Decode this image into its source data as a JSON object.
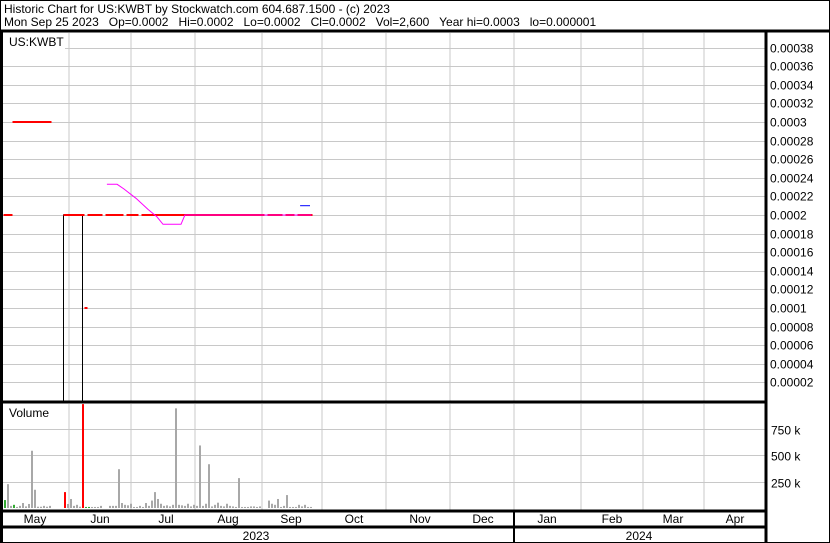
{
  "header": {
    "title_line": "Historic Chart for US:KWBT by Stockwatch.com 604.687.1500 - (c) 2023",
    "quote_line": "Mon Sep 25 2023   Op=0.0002   Hi=0.0002   Lo=0.0002   Cl=0.0002   Vol=2,600   Year hi=0.0003   lo=0.000001"
  },
  "chart_data": {
    "type": "bar",
    "symbol_label": "US:KWBT",
    "volume_label": "Volume",
    "price_axis": {
      "min": 0,
      "max": 0.0004,
      "ticks": [
        "0.00038",
        "0.00036",
        "0.00034",
        "0.00032",
        "0.0003",
        "0.00028",
        "0.00026",
        "0.00024",
        "0.00022",
        "0.0002",
        "0.00018",
        "0.00016",
        "0.00014",
        "0.00012",
        "0.0001",
        "0.00008",
        "0.00006",
        "0.00004",
        "0.00002"
      ]
    },
    "volume_axis": {
      "min": 0,
      "max": 1000000,
      "ticks": [
        {
          "label": "750 k",
          "value": 750000
        },
        {
          "label": "500 k",
          "value": 500000
        },
        {
          "label": "250 k",
          "value": 250000
        }
      ]
    },
    "months": [
      "May",
      "Jun",
      "Jul",
      "Aug",
      "Sep",
      "Oct",
      "Nov",
      "Dec",
      "Jan",
      "Feb",
      "Mar",
      "Apr"
    ],
    "years": [
      "2023",
      "2024"
    ],
    "trading_day_count": 103,
    "closes": [
      0.0002,
      0.0002,
      0.0002,
      0.0003,
      0.0003,
      0.0003,
      0.0003,
      0.0003,
      0.0003,
      0.0003,
      0.0003,
      0.0003,
      0.0003,
      0.0003,
      0.0003,
      0.0003,
      null,
      null,
      null,
      null,
      0.0002,
      0.0002,
      0.0002,
      0.0002,
      0.0002,
      0.0002,
      0.0002,
      0.0001,
      0.0002,
      0.0002,
      0.0002,
      0.0002,
      0.0002,
      null,
      0.0002,
      0.0002,
      0.0002,
      0.0002,
      0.0002,
      0.0002,
      null,
      0.0002,
      0.0002,
      0.0002,
      0.0002,
      null,
      0.0002,
      0.0002,
      0.0002,
      0.0002,
      0.0002,
      0.0002,
      0.0002,
      0.0002,
      0.0002,
      0.0002,
      0.0002,
      0.0002,
      0.0002,
      0.0002,
      0.0002,
      0.0002,
      0.0002,
      0.0002,
      0.0002,
      0.0002,
      0.0002,
      0.0002,
      0.0002,
      0.0002,
      0.0002,
      0.0002,
      0.0002,
      0.0002,
      0.0002,
      0.0002,
      0.0002,
      0.0002,
      0.0002,
      0.0002,
      0.0002,
      0.0002,
      0.0002,
      0.0002,
      0.0002,
      0.0002,
      0.0002,
      null,
      0.0002,
      0.0002,
      0.0002,
      0.0002,
      0.0002,
      null,
      0.0002,
      0.0002,
      0.0002,
      null,
      0.0002,
      0.0002,
      0.0002,
      0.0002,
      0.0002
    ],
    "hollow_candle": {
      "from_day": 20,
      "to_day": 26,
      "high": 0.0002,
      "low": 0
    },
    "moving_average": [
      [
        34.3,
        0.000233
      ],
      [
        37.7,
        0.000233
      ],
      [
        40,
        0.000228
      ],
      [
        44,
        0.000218
      ],
      [
        48,
        0.000206
      ],
      [
        51,
        0.000198
      ],
      [
        53,
        0.00019
      ],
      [
        59,
        0.00019
      ],
      [
        60.3,
        0.0002
      ],
      [
        102.5,
        0.0002
      ]
    ],
    "blue_mark": {
      "from_day": 98.7,
      "to_day": 102,
      "value": 0.00021
    },
    "volumes_k": [
      75,
      225,
      20,
      30,
      10,
      20,
      47,
      15,
      38,
      540,
      172,
      12,
      12,
      20,
      12,
      20,
      0,
      0,
      0,
      0,
      150,
      38,
      85,
      20,
      30,
      12,
      980,
      10,
      10,
      10,
      10,
      10,
      20,
      0,
      0,
      20,
      20,
      20,
      366,
      47,
      30,
      25,
      40,
      10,
      10,
      20,
      10,
      47,
      20,
      70,
      150,
      85,
      40,
      20,
      25,
      15,
      30,
      940,
      30,
      25,
      20,
      40,
      15,
      30,
      20,
      590,
      20,
      40,
      413,
      15,
      30,
      50,
      20,
      15,
      40,
      20,
      15,
      10,
      282,
      10,
      10,
      10,
      15,
      15,
      10,
      15,
      0,
      0,
      70,
      40,
      30,
      85,
      10,
      20,
      122,
      10,
      10,
      10,
      30,
      15,
      30,
      10,
      10
    ],
    "up_days": [
      0,
      3,
      27,
      28
    ],
    "down_days": [
      20,
      26
    ],
    "colors": {
      "price": "#ff0000",
      "ma": "#ff00ff",
      "blue": "#0000ff",
      "volume": "#a8a8a8",
      "up": "#33aa33",
      "down": "#ff0000",
      "grid": "#c8c8c8"
    }
  }
}
